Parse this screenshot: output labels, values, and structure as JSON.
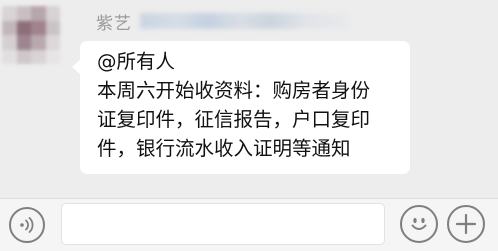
{
  "message": {
    "sender_name": "紫艺",
    "lines": [
      "@所有人",
      "本周六开始收资料：购房者身份",
      "证复印件，征信报告，户口复印",
      "件，银行流水收入证明等通知"
    ]
  },
  "input_bar": {
    "voice_icon": "voice-icon",
    "emoji_icon": "emoji-icon",
    "plus_icon": "plus-icon",
    "text_value": ""
  },
  "colors": {
    "background": "#ededed",
    "bubble": "#ffffff",
    "sender_name": "#9a9a9a",
    "icon_stroke": "#7f7f7f"
  }
}
